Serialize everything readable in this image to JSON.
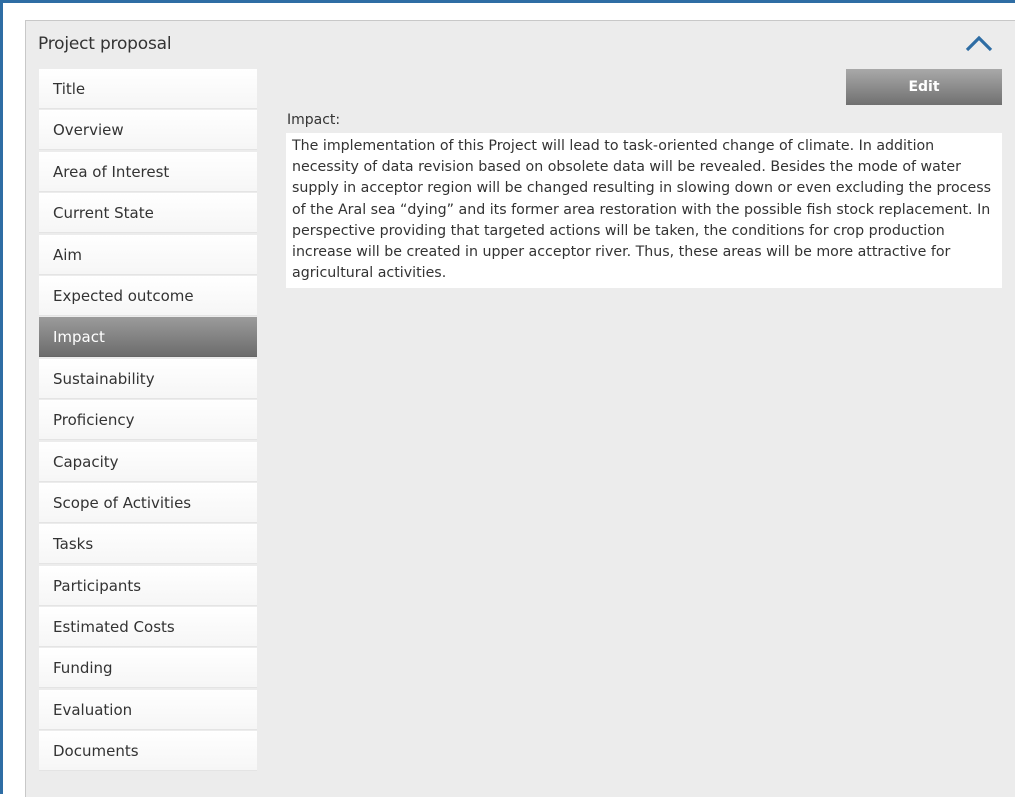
{
  "panel": {
    "title": "Project proposal",
    "collapse_icon": "chevron-up-icon",
    "accent_color": "#2e6da4"
  },
  "nav": {
    "active_index": 6,
    "items": [
      {
        "label": "Title"
      },
      {
        "label": "Overview"
      },
      {
        "label": "Area of Interest"
      },
      {
        "label": "Current State"
      },
      {
        "label": "Aim"
      },
      {
        "label": "Expected outcome"
      },
      {
        "label": "Impact"
      },
      {
        "label": "Sustainability"
      },
      {
        "label": "Proficiency"
      },
      {
        "label": "Capacity"
      },
      {
        "label": "Scope of Activities"
      },
      {
        "label": "Tasks"
      },
      {
        "label": "Participants"
      },
      {
        "label": "Estimated Costs"
      },
      {
        "label": "Funding"
      },
      {
        "label": "Evaluation"
      },
      {
        "label": "Documents"
      }
    ]
  },
  "content": {
    "edit_label": "Edit",
    "field_label": "Impact:",
    "field_text": "The implementation of this Project will lead to task-oriented change of climate. In addition necessity of data revision based on obsolete data will be revealed. Besides the mode of water supply in acceptor region will be changed resulting in slowing down or even excluding the process of the Aral sea “dying” and its former area restoration with the possible fish stock replacement. In perspective providing that targeted actions will be taken, the conditions for crop production increase will be created in upper acceptor river. Thus, these areas will be more attractive for agricultural activities."
  }
}
